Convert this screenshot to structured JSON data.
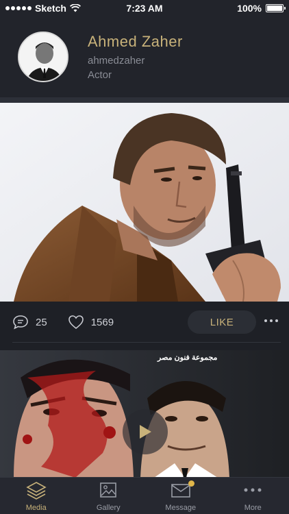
{
  "status_bar": {
    "carrier": "Sketch",
    "time": "7:23 AM",
    "battery": "100%",
    "battery_level": 1.0
  },
  "profile": {
    "name": "Ahmed Zaher",
    "handle": "ahmedzaher",
    "role": "Actor"
  },
  "post": {
    "comments": "25",
    "likes": "1569",
    "like_label": "LIKE",
    "comment_icon": "comment-icon",
    "heart_icon": "heart-icon",
    "more_icon": "more-dots-icon"
  },
  "video": {
    "play_icon": "play-icon",
    "watermark": "مجموعة فنون مصر"
  },
  "tabs": [
    {
      "label": "Media",
      "icon": "layers-icon",
      "active": true
    },
    {
      "label": "Gallery",
      "icon": "image-icon",
      "active": false
    },
    {
      "label": "Message",
      "icon": "envelope-icon",
      "active": false
    },
    {
      "label": "More",
      "icon": "more-icon",
      "active": false
    }
  ],
  "colors": {
    "accent": "#c8b27a",
    "background": "#1e2026",
    "header": "#22242b",
    "badge": "#e0b64a"
  }
}
